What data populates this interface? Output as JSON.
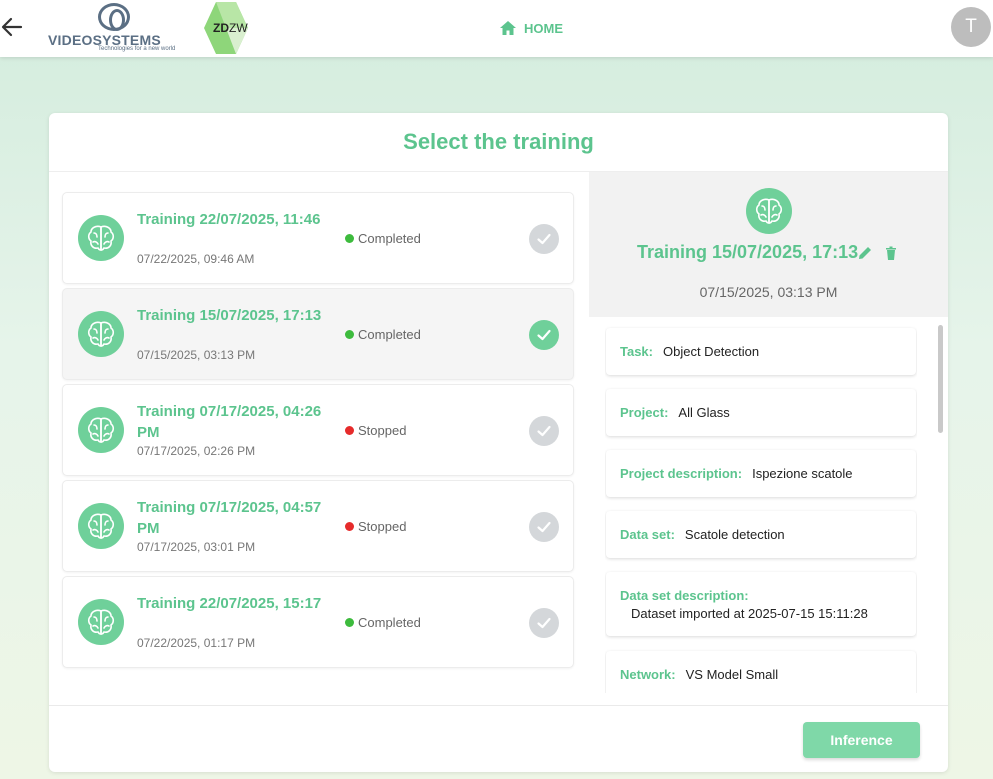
{
  "header": {
    "logo_name": "VIDEOSYSTEMS",
    "logo_tagline": "Technologies for a new world",
    "zd_logo_bold": "ZD",
    "zd_logo_rest": "ZW",
    "home_label": "HOME",
    "avatar_initial": "T"
  },
  "page_title": "Select the training",
  "trainings": [
    {
      "title": "Training 22/07/2025, 11:46",
      "date": "07/22/2025, 09:46 AM",
      "status": "Completed",
      "status_color": "#3dbb3d",
      "selected": false
    },
    {
      "title": "Training 15/07/2025, 17:13",
      "date": "07/15/2025, 03:13 PM",
      "status": "Completed",
      "status_color": "#3dbb3d",
      "selected": true
    },
    {
      "title": "Training 07/17/2025, 04:26 PM",
      "date": "07/17/2025, 02:26 PM",
      "status": "Stopped",
      "status_color": "#e62b2b",
      "selected": false
    },
    {
      "title": "Training 07/17/2025, 04:57 PM",
      "date": "07/17/2025, 03:01 PM",
      "status": "Stopped",
      "status_color": "#e62b2b",
      "selected": false
    },
    {
      "title": "Training 22/07/2025, 15:17",
      "date": "07/22/2025, 01:17 PM",
      "status": "Completed",
      "status_color": "#3dbb3d",
      "selected": false
    }
  ],
  "detail": {
    "title": "Training 15/07/2025, 17:13",
    "date": "07/15/2025, 03:13 PM",
    "fields": [
      {
        "label": "Task:",
        "value": "Object Detection",
        "stacked": false
      },
      {
        "label": "Project:",
        "value": "All Glass",
        "stacked": false
      },
      {
        "label": "Project description:",
        "value": "Ispezione scatole",
        "stacked": false
      },
      {
        "label": "Data set:",
        "value": "Scatole detection",
        "stacked": false
      },
      {
        "label": "Data set description:",
        "value": "Dataset imported at 2025-07-15 15:11:28",
        "stacked": true
      },
      {
        "label": "Network:",
        "value": "VS Model Small",
        "stacked": false
      }
    ]
  },
  "inference_label": "Inference",
  "colors": {
    "accent": "#5cc48e",
    "brain_bg": "#6fd09a",
    "check_inactive": "#d4d7da",
    "button": "#7fd8a8"
  }
}
